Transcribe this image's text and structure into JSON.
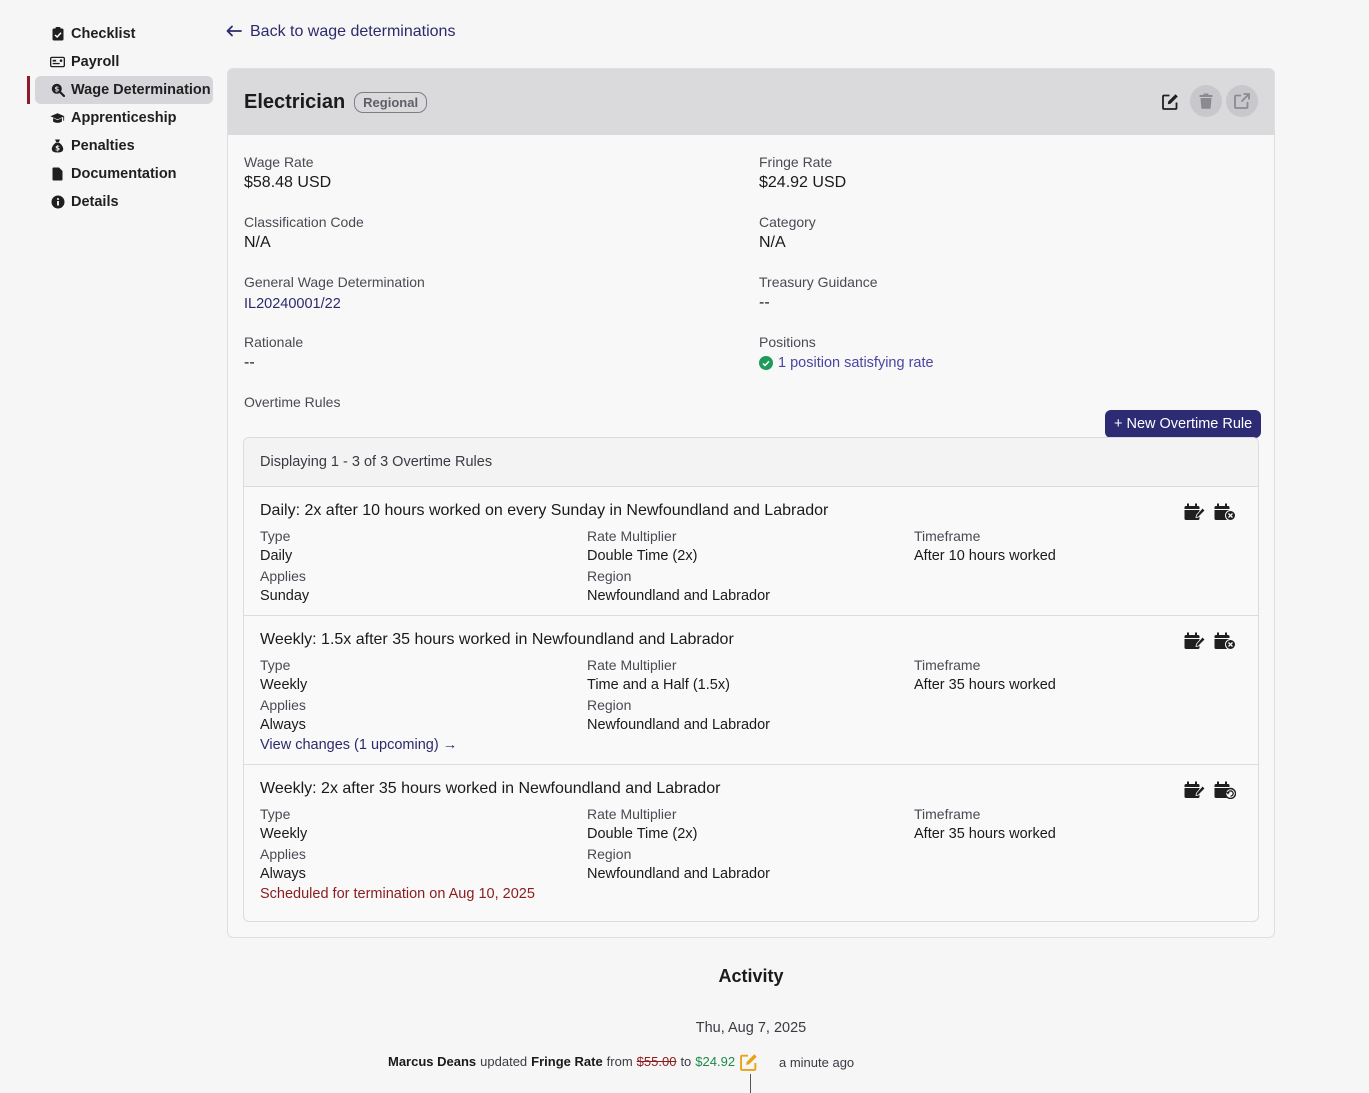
{
  "sidebar": {
    "items": [
      {
        "label": "Checklist",
        "icon": "clipboard-check-icon",
        "active": false
      },
      {
        "label": "Payroll",
        "icon": "money-check-icon",
        "active": false
      },
      {
        "label": "Wage Determination",
        "icon": "search-dollar-icon",
        "active": true
      },
      {
        "label": "Apprenticeship",
        "icon": "graduation-cap-icon",
        "active": false
      },
      {
        "label": "Penalties",
        "icon": "money-bag-icon",
        "active": false
      },
      {
        "label": "Documentation",
        "icon": "file-icon",
        "active": false
      },
      {
        "label": "Details",
        "icon": "info-circle-icon",
        "active": false
      }
    ]
  },
  "back_link": {
    "label": "Back to wage determinations"
  },
  "header": {
    "title": "Electrician",
    "badge": "Regional"
  },
  "fields": {
    "wage_rate": {
      "label": "Wage Rate",
      "value": "$58.48 USD"
    },
    "fringe_rate": {
      "label": "Fringe Rate",
      "value": "$24.92 USD"
    },
    "classification_code": {
      "label": "Classification Code",
      "value": "N/A"
    },
    "category": {
      "label": "Category",
      "value": "N/A"
    },
    "general_wage_determination": {
      "label": "General Wage Determination",
      "value": "IL20240001/22"
    },
    "treasury_guidance": {
      "label": "Treasury Guidance",
      "value": "--"
    },
    "rationale": {
      "label": "Rationale",
      "value": "--"
    },
    "positions": {
      "label": "Positions",
      "value": "1 position satisfying rate"
    }
  },
  "overtime": {
    "section_label": "Overtime Rules",
    "new_button": "+ New Overtime Rule",
    "summary": "Displaying 1 - 3 of 3 Overtime Rules",
    "labels": {
      "type": "Type",
      "rate_multiplier": "Rate Multiplier",
      "timeframe": "Timeframe",
      "applies": "Applies",
      "region": "Region"
    },
    "rules": [
      {
        "title": "Daily: 2x after 10 hours worked on every Sunday in Newfoundland and Labrador",
        "type": "Daily",
        "rate_multiplier": "Double Time (2x)",
        "timeframe": "After 10 hours worked",
        "applies": "Sunday",
        "region": "Newfoundland and Labrador"
      },
      {
        "title": "Weekly: 1.5x after 35 hours worked in Newfoundland and Labrador",
        "type": "Weekly",
        "rate_multiplier": "Time and a Half (1.5x)",
        "timeframe": "After 35 hours worked",
        "applies": "Always",
        "region": "Newfoundland and Labrador",
        "link": "View changes (1 upcoming) →"
      },
      {
        "title": "Weekly: 2x after 35 hours worked in Newfoundland and Labrador",
        "type": "Weekly",
        "rate_multiplier": "Double Time (2x)",
        "timeframe": "After 35 hours worked",
        "applies": "Always",
        "region": "Newfoundland and Labrador",
        "note": "Scheduled for termination on Aug 10, 2025"
      }
    ]
  },
  "activity": {
    "title": "Activity",
    "date": "Thu, Aug 7, 2025",
    "entry": {
      "user": "Marcus Deans",
      "action": "updated",
      "field": "Fringe Rate",
      "from_word": "from",
      "old_value": "$55.00",
      "to_word": "to",
      "new_value": "$24.92",
      "time": "a minute ago"
    }
  },
  "colors": {
    "accent": "#2e2b75",
    "active_bar": "#8a1c2b",
    "success": "#1e9a5a",
    "danger": "#8a1c1c"
  }
}
